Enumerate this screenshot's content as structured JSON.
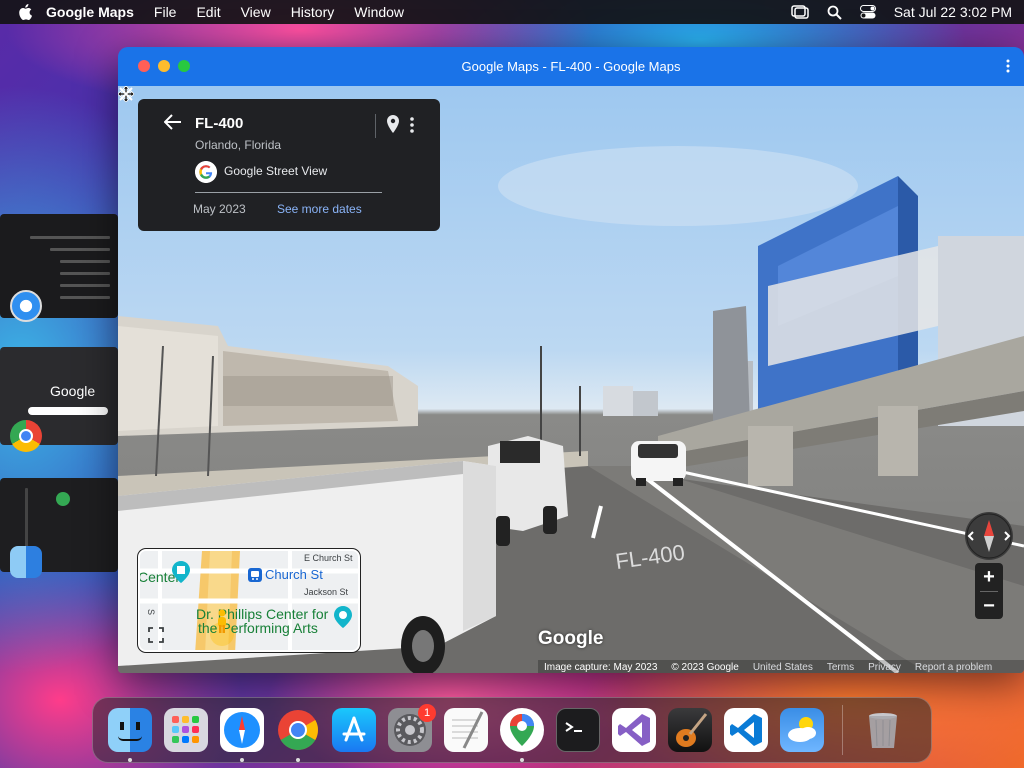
{
  "menubar": {
    "app_name": "Google Maps",
    "items": [
      "File",
      "Edit",
      "View",
      "History",
      "Window"
    ],
    "clock": "Sat Jul 22  3:02 PM"
  },
  "window": {
    "title": "Google Maps - FL-400 - Google Maps"
  },
  "info_card": {
    "place": "FL-400",
    "subplace": "Orlando, Florida",
    "source": "Google Street View",
    "date": "May 2023",
    "more_dates": "See more dates"
  },
  "minimap": {
    "labels": {
      "e_church": "E Church St",
      "jackson": "Jackson St",
      "s": "S",
      "center": "Center",
      "church_station": "Church St",
      "dr_phillips_1": "Dr. Phillips Center for",
      "dr_phillips_2": "the Performing Arts"
    }
  },
  "watermark": "Google",
  "footer": {
    "capture": "Image capture: May 2023",
    "copyright": "© 2023 Google",
    "region": "United States",
    "terms": "Terms",
    "privacy": "Privacy",
    "report": "Report a problem"
  },
  "zoom": {
    "in": "+",
    "out": "−"
  },
  "dock": {
    "apps": [
      "Finder",
      "Launchpad",
      "Safari",
      "Chrome",
      "App Store",
      "System Settings",
      "TextEdit",
      "Google Maps",
      "Terminal",
      "Visual Studio",
      "GarageBand",
      "VS Code",
      "Weather",
      "Trash"
    ],
    "settings_badge": "1"
  },
  "thumb_google": "Google",
  "colors": {
    "titlebar": "#1a73e8",
    "card_bg": "#202124",
    "link": "#8ab4f8"
  }
}
